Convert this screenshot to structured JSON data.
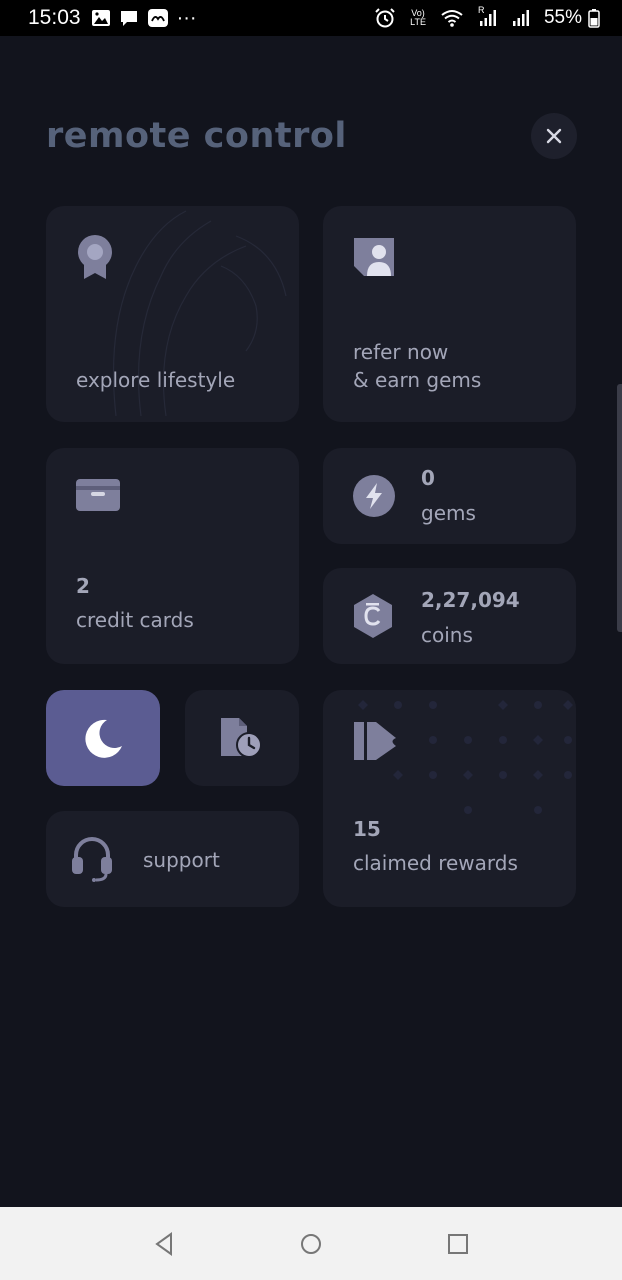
{
  "status_bar": {
    "time": "15:03",
    "more": "···",
    "volte_top": "Vo)",
    "volte_bottom": "LTE",
    "roaming": "R",
    "battery": "55%"
  },
  "header": {
    "title": "remote control"
  },
  "cards": {
    "lifestyle": {
      "label": "explore lifestyle"
    },
    "refer": {
      "line1": "refer now",
      "line2": "& earn gems"
    },
    "credit_cards": {
      "count": "2",
      "label": "credit cards"
    },
    "gems": {
      "count": "0",
      "label": "gems"
    },
    "coins": {
      "count": "2,27,094",
      "label": "coins"
    },
    "support": {
      "label": "support"
    },
    "rewards": {
      "count": "15",
      "label": "claimed rewards"
    }
  },
  "colors": {
    "background": "#12141d",
    "card": "#1b1d28",
    "accent": "#5b5c92",
    "text": "#a3a6b8",
    "title": "#56627a",
    "icon": "#7e7f9c"
  }
}
